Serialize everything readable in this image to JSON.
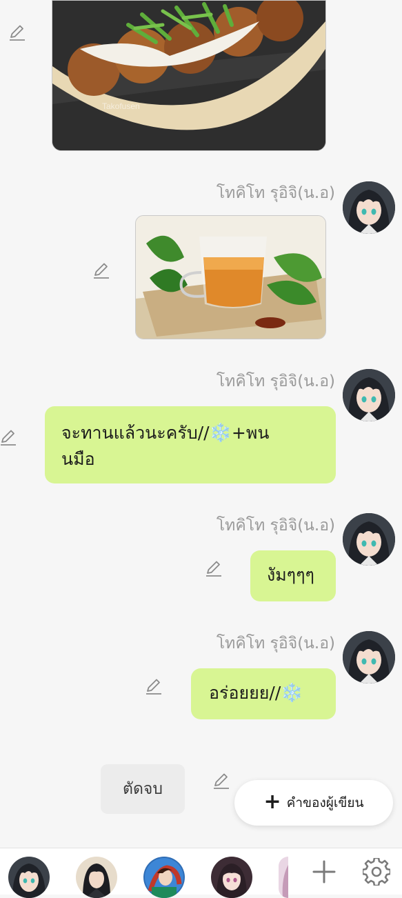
{
  "messages": [
    {
      "type": "image",
      "image_name": "takoyaki-photo",
      "caption_watermark": "Takofusen"
    },
    {
      "type": "image",
      "sender": "โทคิโท รุอิจิ(น.อ)",
      "image_name": "tea-photo"
    },
    {
      "type": "text",
      "sender": "โทคิโท รุอิจิ(น.อ)",
      "line1": "จะทานแล้วนะครับ//",
      "line1_suffix": "+พน",
      "line2": "นมือ"
    },
    {
      "type": "text",
      "sender": "โทคิโท รุอิจิ(น.อ)",
      "text": "งัมๆๆๆ"
    },
    {
      "type": "text",
      "sender": "โทคิโท รุอิจิ(น.อ)",
      "text": "อร่อยยย//"
    }
  ],
  "snowflake_glyph": "❄️",
  "cut_button_label": "ตัดจบ",
  "author_note_button_label": "คำของผู้เขียน",
  "author_note_plus": "+",
  "icons": {
    "edit": "pencil-icon",
    "add": "plus-icon",
    "settings": "gear-icon",
    "snow": "snowflake-emoji"
  },
  "colors": {
    "bubble": "#d8f593",
    "background": "#f6f6f6",
    "name_text": "#9a9a9a"
  }
}
